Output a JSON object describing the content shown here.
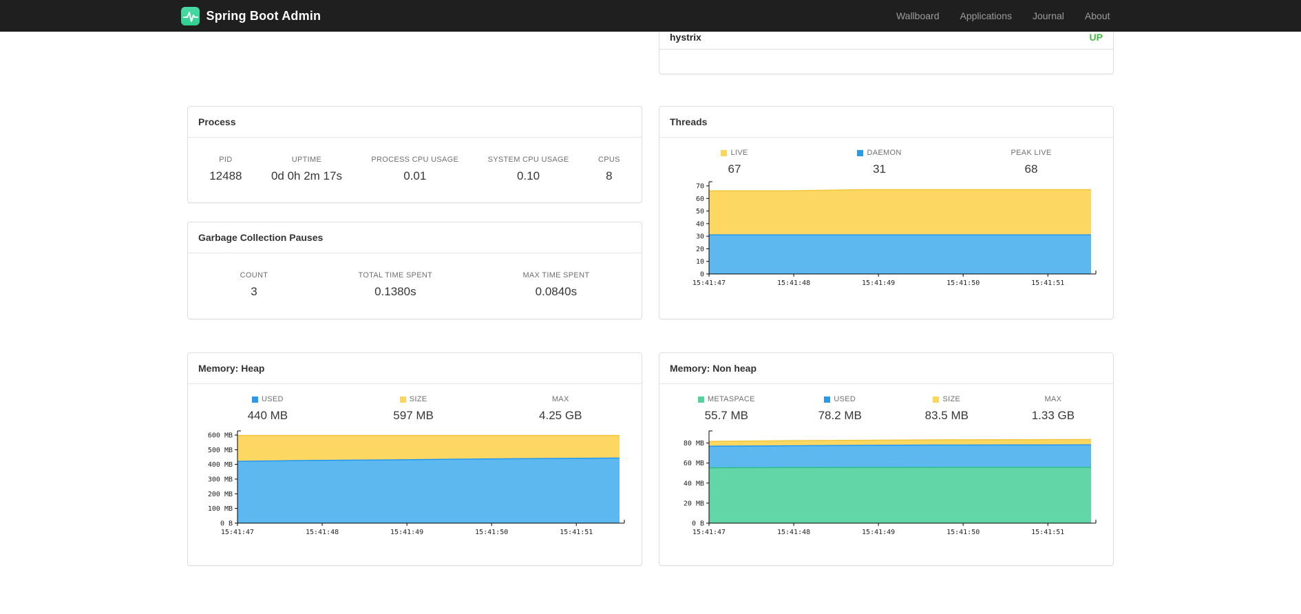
{
  "colors": {
    "status_up": "#3cbf3c"
  },
  "navbar": {
    "brand": "Spring Boot Admin",
    "items": [
      {
        "label": "Wallboard"
      },
      {
        "label": "Applications"
      },
      {
        "label": "Journal"
      },
      {
        "label": "About"
      }
    ]
  },
  "health": {
    "rows": [
      {
        "name": "hystrix",
        "status": "UP"
      }
    ]
  },
  "process": {
    "title": "Process",
    "metrics": [
      {
        "label": "PID",
        "value": "12488"
      },
      {
        "label": "UPTIME",
        "value": "0d 0h 2m 17s"
      },
      {
        "label": "PROCESS CPU USAGE",
        "value": "0.01"
      },
      {
        "label": "SYSTEM CPU USAGE",
        "value": "0.10"
      },
      {
        "label": "CPUS",
        "value": "8"
      }
    ]
  },
  "gc": {
    "title": "Garbage Collection Pauses",
    "metrics": [
      {
        "label": "COUNT",
        "value": "3"
      },
      {
        "label": "TOTAL TIME SPENT",
        "value": "0.1380s"
      },
      {
        "label": "MAX TIME SPENT",
        "value": "0.0840s"
      }
    ]
  },
  "threads": {
    "title": "Threads",
    "legend": [
      {
        "label": "LIVE",
        "value": "67",
        "color": "#fbd55e"
      },
      {
        "label": "DAEMON",
        "value": "31",
        "color": "#2b99e8"
      },
      {
        "label": "PEAK LIVE",
        "value": "68"
      }
    ]
  },
  "heap": {
    "title": "Memory: Heap",
    "legend": [
      {
        "label": "USED",
        "value": "440 MB",
        "color": "#2b99e8"
      },
      {
        "label": "SIZE",
        "value": "597 MB",
        "color": "#fbd55e"
      },
      {
        "label": "MAX",
        "value": "4.25 GB"
      }
    ]
  },
  "nonheap": {
    "title": "Memory: Non heap",
    "legend": [
      {
        "label": "METASPACE",
        "value": "55.7 MB",
        "color": "#57d0a0"
      },
      {
        "label": "USED",
        "value": "78.2 MB",
        "color": "#2b99e8"
      },
      {
        "label": "SIZE",
        "value": "83.5 MB",
        "color": "#fbd55e"
      },
      {
        "label": "MAX",
        "value": "1.33 GB"
      }
    ]
  },
  "chart_data": [
    {
      "id": "threads-chart",
      "type": "area",
      "title": "Threads",
      "x": [
        "15:41:47",
        "15:41:48",
        "15:41:49",
        "15:41:50",
        "15:41:51"
      ],
      "ylim": [
        0,
        70
      ],
      "yticks": [
        {
          "v": 0,
          "label": "0"
        },
        {
          "v": 10,
          "label": "10"
        },
        {
          "v": 20,
          "label": "20"
        },
        {
          "v": 30,
          "label": "30"
        },
        {
          "v": 40,
          "label": "40"
        },
        {
          "v": 50,
          "label": "50"
        },
        {
          "v": 60,
          "label": "60"
        },
        {
          "v": 70,
          "label": "70"
        }
      ],
      "series": [
        {
          "name": "LIVE",
          "fill": "#fcd862",
          "line": "#f0c63e",
          "values": [
            66,
            66,
            67,
            67,
            67,
            67
          ]
        },
        {
          "name": "DAEMON",
          "fill": "#5db8f0",
          "line": "#2196f3",
          "values": [
            31,
            31,
            31,
            31,
            31,
            31
          ]
        }
      ]
    },
    {
      "id": "heap-chart",
      "type": "area",
      "title": "Memory: Heap",
      "unit": "MB",
      "x": [
        "15:41:47",
        "15:41:48",
        "15:41:49",
        "15:41:50",
        "15:41:51"
      ],
      "ylim": [
        0,
        600
      ],
      "yticks": [
        {
          "v": 0,
          "label": "0 B"
        },
        {
          "v": 100,
          "label": "100 MB"
        },
        {
          "v": 200,
          "label": "200 MB"
        },
        {
          "v": 300,
          "label": "300 MB"
        },
        {
          "v": 400,
          "label": "400 MB"
        },
        {
          "v": 500,
          "label": "500 MB"
        },
        {
          "v": 600,
          "label": "600 MB"
        }
      ],
      "series": [
        {
          "name": "SIZE",
          "fill": "#fcd862",
          "line": "#f0c63e",
          "values": [
            597,
            597,
            597,
            597,
            597,
            597
          ]
        },
        {
          "name": "USED",
          "fill": "#5db8f0",
          "line": "#2196f3",
          "values": [
            421,
            427,
            431,
            436,
            440,
            443
          ]
        }
      ]
    },
    {
      "id": "nonheap-chart",
      "type": "area",
      "title": "Memory: Non heap",
      "unit": "MB",
      "x": [
        "15:41:47",
        "15:41:48",
        "15:41:49",
        "15:41:50",
        "15:41:51"
      ],
      "ylim": [
        0,
        88
      ],
      "yticks": [
        {
          "v": 0,
          "label": "0 B"
        },
        {
          "v": 20,
          "label": "20 MB"
        },
        {
          "v": 40,
          "label": "40 MB"
        },
        {
          "v": 60,
          "label": "60 MB"
        },
        {
          "v": 80,
          "label": "80 MB"
        }
      ],
      "series": [
        {
          "name": "SIZE",
          "fill": "#fcd862",
          "line": "#f0c63e",
          "values": [
            81.6,
            82.3,
            82.8,
            83.2,
            83.4,
            83.5
          ]
        },
        {
          "name": "USED",
          "fill": "#5db8f0",
          "line": "#2196f3",
          "values": [
            76.8,
            77.3,
            77.7,
            78.0,
            78.1,
            78.2
          ]
        },
        {
          "name": "METASPACE",
          "fill": "#62d6a6",
          "line": "#2fbd8a",
          "values": [
            55.3,
            55.5,
            55.6,
            55.7,
            55.7,
            55.7
          ]
        }
      ]
    }
  ]
}
